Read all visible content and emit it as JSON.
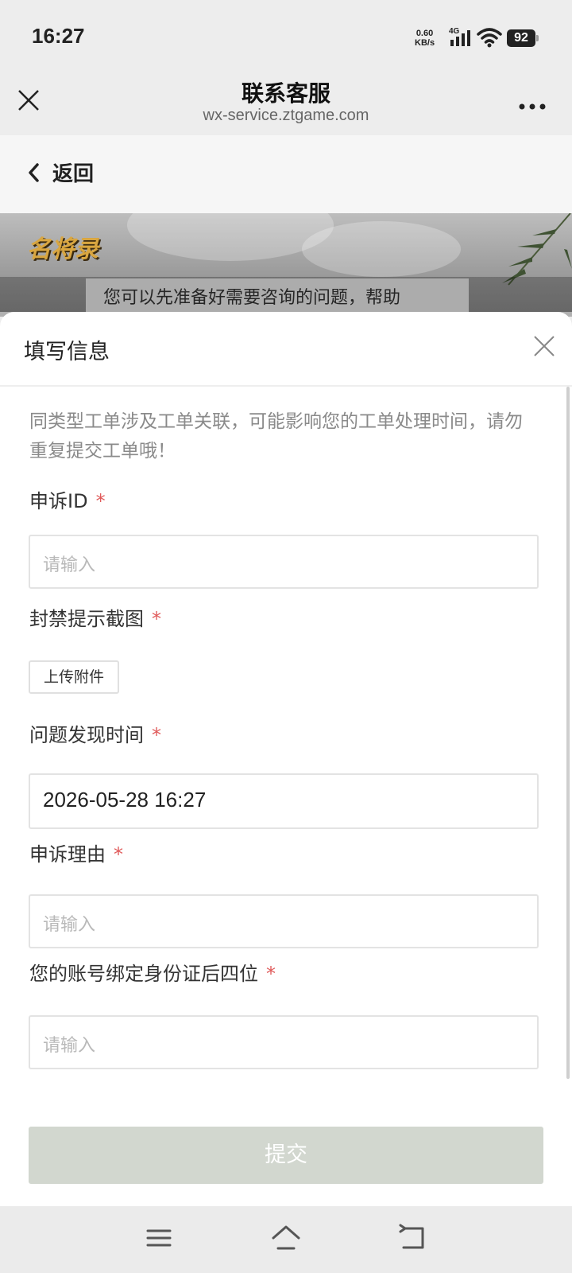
{
  "status": {
    "time": "16:27",
    "net_speed_value": "0.60",
    "net_speed_unit": "KB/s",
    "network": "4G",
    "battery": "92",
    "icons": [
      "signal-icon",
      "wifi-icon",
      "battery-icon"
    ]
  },
  "wx": {
    "title": "联系客服",
    "url": "wx-service.ztgame.com",
    "icons": [
      "close-icon",
      "more-icon"
    ]
  },
  "back": {
    "label": "返回",
    "icon": "chevron-left-icon"
  },
  "banner": {
    "logo_text": "名将录",
    "intro_text": "您可以先准备好需要咨询的问题，帮助"
  },
  "sheet": {
    "title": "填写信息",
    "notice": "同类型工单涉及工单关联，可能影响您的工单处理时间，请勿重复提交工单哦！",
    "required_mark": "*",
    "fields": [
      {
        "label": "申诉ID",
        "placeholder": "请输入",
        "value": ""
      },
      {
        "label": "封禁提示截图",
        "button": "上传附件"
      },
      {
        "label": "问题发现时间",
        "value": "2026-05-28 16:27"
      },
      {
        "label": "申诉理由",
        "placeholder": "请输入",
        "value": ""
      },
      {
        "label": "您的账号绑定身份证后四位",
        "placeholder": "请输入",
        "value": ""
      }
    ],
    "submit": "提交"
  },
  "sys_nav": {
    "icons": [
      "menu-icon",
      "home-icon",
      "back-icon"
    ]
  },
  "colors": {
    "required": "#e05a5a",
    "submit_bg": "#d2d7cf",
    "placeholder": "#b9b9b9"
  }
}
